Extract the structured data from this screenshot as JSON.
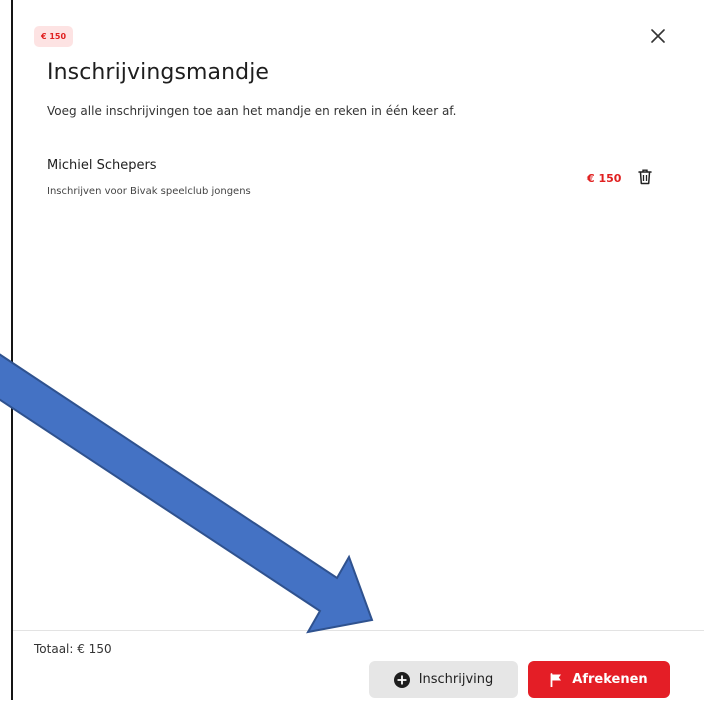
{
  "modal": {
    "price_badge": "€ 150",
    "title": "Inschrijvingsmandje",
    "subtitle": "Voeg alle inschrijvingen toe aan het mandje en reken in één keer af.",
    "close_icon": "close-icon"
  },
  "cart": {
    "items": [
      {
        "name": "Michiel Schepers",
        "description": "Inschrijven voor Bivak speelclub jongens",
        "price": "€ 150",
        "delete_icon": "trash-icon"
      }
    ]
  },
  "footer": {
    "total": "Totaal: € 150",
    "add_button": {
      "label": "Inschrijving",
      "icon": "plus-circle-icon"
    },
    "checkout_button": {
      "label": "Afrekenen",
      "icon": "flag-icon"
    }
  },
  "annotation": {
    "type": "arrow",
    "color": "#4472c4"
  },
  "colors": {
    "accent": "#e41e26",
    "badge_bg": "#fde3e3",
    "secondary_bg": "#e6e6e6"
  }
}
